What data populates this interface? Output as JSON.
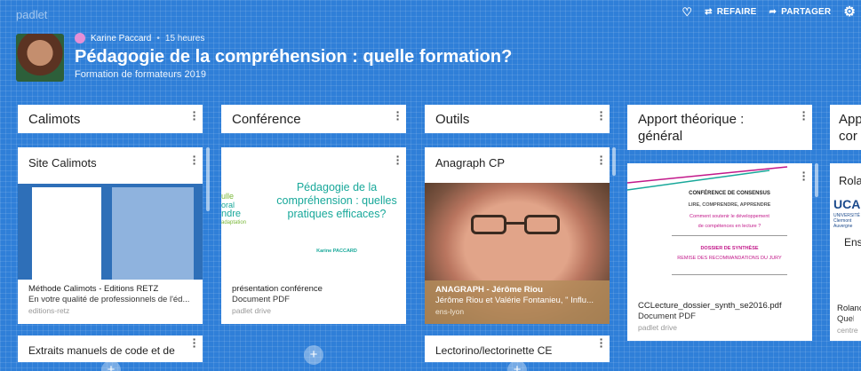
{
  "app": {
    "brand": "padlet"
  },
  "topbar": {
    "heart_icon": "heart-icon",
    "remix_label": "REFAIRE",
    "share_label": "PARTAGER",
    "settings_icon": "gear-icon"
  },
  "header": {
    "author": "Karine Paccard",
    "separator": "•",
    "time": "15 heures",
    "title": "Pédagogie de la compréhension : quelle formation?",
    "subtitle": "Formation de formateurs 2019"
  },
  "columns": [
    {
      "label": "Calimots"
    },
    {
      "label": "Conférence"
    },
    {
      "label": "Outils"
    },
    {
      "label_line1": "Apport théorique :",
      "label_line2": "général"
    },
    {
      "label_line1": "App",
      "label_line2": "cor"
    }
  ],
  "cards": {
    "calimots": {
      "title": "Site Calimots",
      "line1": "Méthode Calimots - Editions RETZ",
      "line2": "En votre qualité de professionnels de l'éd...",
      "line3": "editions-retz",
      "next_title": "Extraits manuels de code et de"
    },
    "conference": {
      "preview_title": "Pédagogie de la compréhension : quelles pratiques efficaces?",
      "preview_author": "Karine PACCARD",
      "preview_words": [
        "ulle",
        "oral",
        "ndre",
        "adaptation"
      ],
      "line1": "présentation conférence",
      "line2": "Document PDF",
      "line3": "padlet drive"
    },
    "outils": {
      "title": "Anagraph CP",
      "line1": "ANAGRAPH - Jérôme Riou",
      "line2": "Jérôme Riou et Valérie Fontanieu, \" Influ...",
      "line3": "ens-lyon",
      "next_title": "Lectorino/lectorinette CE"
    },
    "apport": {
      "doc_title": "CONFÉRENCE DE CONSENSUS",
      "doc_sub": "LIRE, COMPRENDRE, APPRENDRE",
      "doc_q1": "Comment soutenir le développement",
      "doc_q2": "de compétences en lecture ?",
      "doc_synth": "DOSSIER DE SYNTHÈSE",
      "doc_remise": "REMISE DES RECOMMANDATIONS DU JURY",
      "line1": "CCLecture_dossier_synth_se2016.pdf",
      "line2": "Document PDF",
      "line3": "padlet drive"
    },
    "last": {
      "title": "Rola",
      "logo": "UCA",
      "logo_sub1": "UNIVERSITÉ",
      "logo_sub2": "Clermont",
      "logo_sub3": "Auvergne",
      "text": "Ens",
      "line1": "Rolanc",
      "line2": "Quels",
      "line3": "centre"
    }
  },
  "add_symbol": "+",
  "colors": {
    "background": "#2f7fd8",
    "card": "#ffffff",
    "accent_teal": "#18a89a",
    "accent_pink": "#c2188a"
  }
}
